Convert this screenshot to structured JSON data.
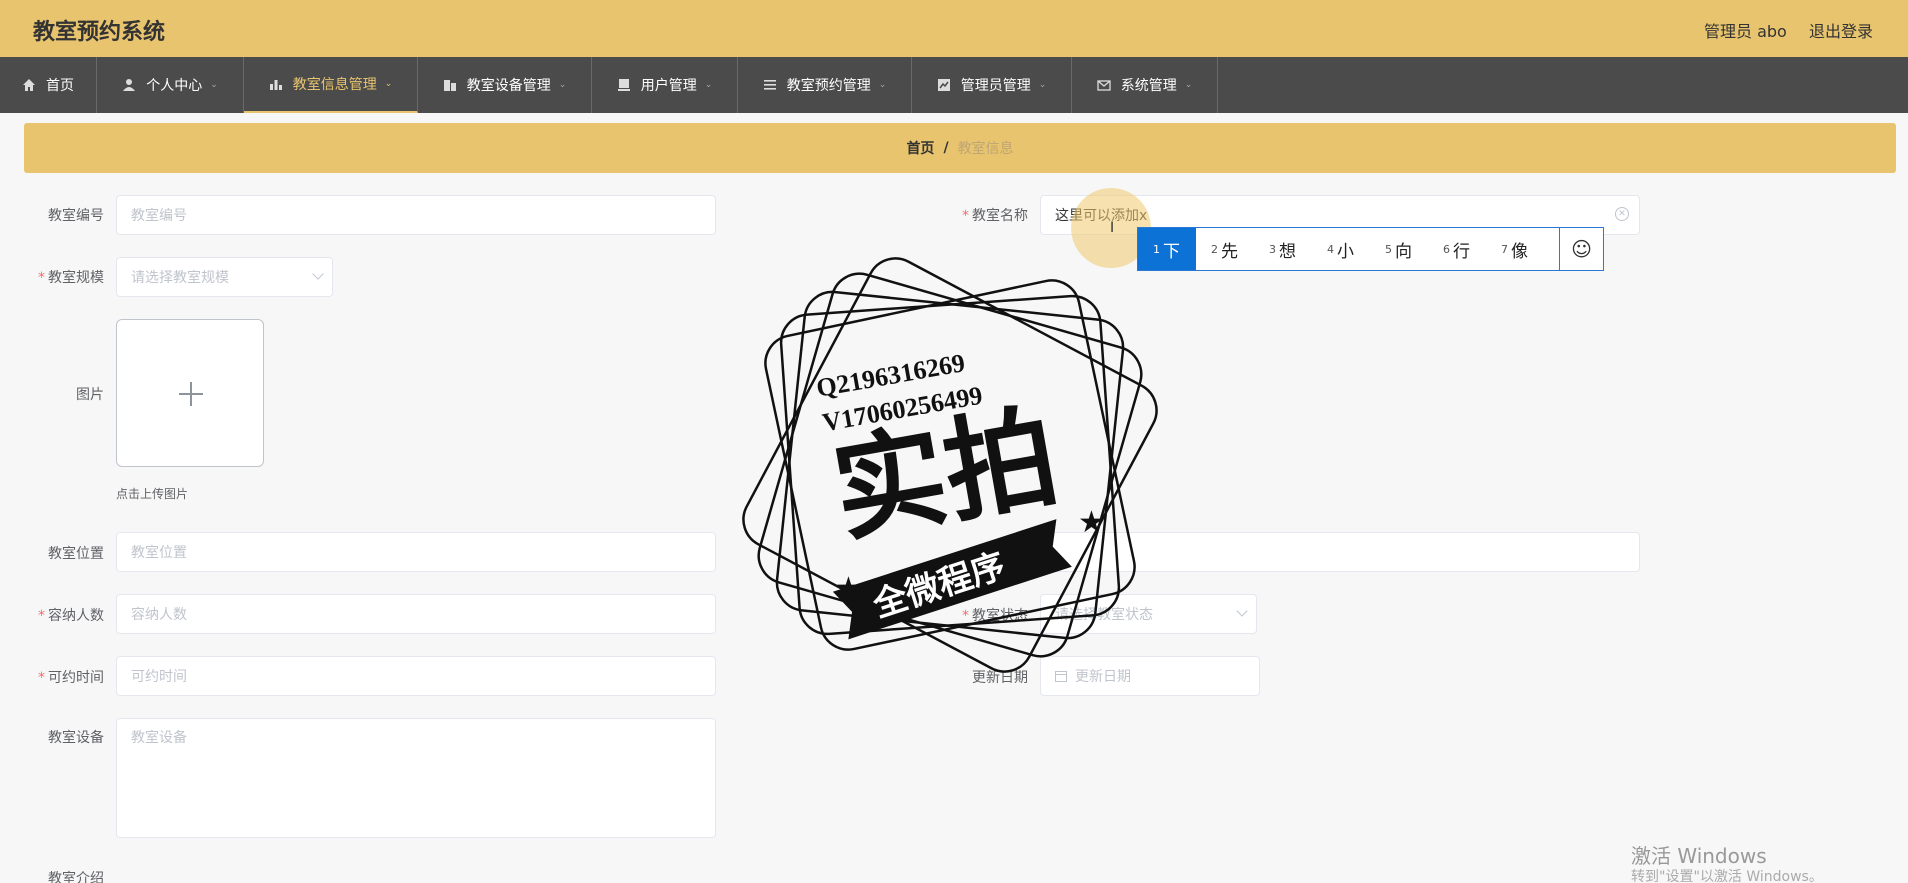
{
  "header": {
    "app_title": "教室预约系统",
    "admin_label": "管理员 abo",
    "logout_label": "退出登录"
  },
  "nav": [
    {
      "label": "首页",
      "icon": "home-icon"
    },
    {
      "label": "个人中心",
      "icon": "user-icon"
    },
    {
      "label": "教室信息管理",
      "icon": "bar-chart-icon",
      "active": true
    },
    {
      "label": "教室设备管理",
      "icon": "building-icon"
    },
    {
      "label": "用户管理",
      "icon": "user-card-icon"
    },
    {
      "label": "教室预约管理",
      "icon": "list-icon"
    },
    {
      "label": "管理员管理",
      "icon": "line-chart-icon"
    },
    {
      "label": "系统管理",
      "icon": "mail-icon"
    }
  ],
  "breadcrumb": {
    "home": "首页",
    "sep": "/",
    "current": "教室信息"
  },
  "form": {
    "room_no_label": "教室编号",
    "room_no_placeholder": "教室编号",
    "room_name_label": "教室名称",
    "room_name_value": "这里可以添加x",
    "room_scale_label": "教室规模",
    "room_scale_placeholder": "请选择教室规模",
    "image_label": "图片",
    "upload_hint": "点击上传图片",
    "location_label": "教室位置",
    "location_placeholder": "教室位置",
    "capacity_label": "容纳人数",
    "capacity_placeholder": "容纳人数",
    "status_label": "教室状态",
    "status_placeholder": "请选择教室状态",
    "bookable_time_label": "可约时间",
    "bookable_time_placeholder": "可约时间",
    "update_date_label": "更新日期",
    "update_date_placeholder": "更新日期",
    "equipment_label": "教室设备",
    "equipment_placeholder": "教室设备",
    "intro_label": "教室介绍"
  },
  "ime": {
    "candidates": [
      {
        "num": "1",
        "text": "下"
      },
      {
        "num": "2",
        "text": "先"
      },
      {
        "num": "3",
        "text": "想"
      },
      {
        "num": "4",
        "text": "小"
      },
      {
        "num": "5",
        "text": "向"
      },
      {
        "num": "6",
        "text": "行"
      },
      {
        "num": "7",
        "text": "像"
      }
    ],
    "emoji": "☺"
  },
  "watermark": {
    "line1": "Q2196316269",
    "line2": "V17060256499",
    "big": "实拍",
    "ribbon": "全微程序"
  },
  "windows": {
    "activate": "激活 Windows",
    "activate_sub": "转到\"设置\"以激活 Windows。"
  }
}
